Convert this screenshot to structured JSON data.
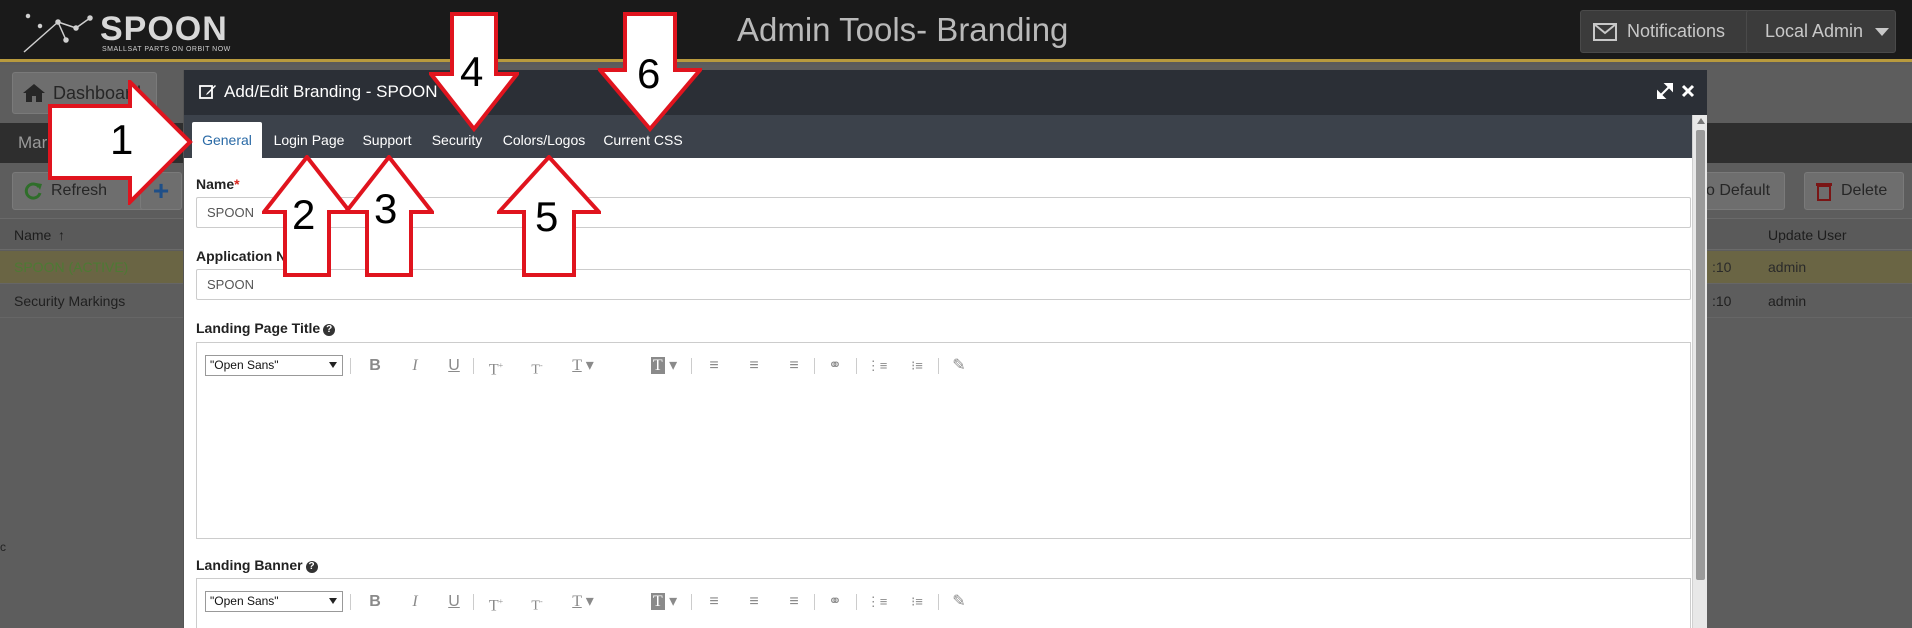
{
  "app": {
    "logo_text": "SPOON",
    "logo_tagline": "SMALLSAT PARTS ON ORBIT NOW",
    "title": "Admin Tools- Branding",
    "notifications_label": "Notifications",
    "user_label": "Local Admin"
  },
  "background": {
    "breadcrumb_label": "Dashboard",
    "strip_label": "Mar",
    "refresh_label": "Refresh",
    "add_label": "+",
    "default_label": "o Default",
    "delete_label": "Delete",
    "table": {
      "col_name": "Name",
      "col_update_user": "Update User",
      "rows": [
        {
          "name": "SPOON (ACTIVE)",
          "time": ":10",
          "user": "admin"
        },
        {
          "name": "Security Markings",
          "time": ":10",
          "user": "admin"
        }
      ]
    }
  },
  "modal": {
    "title": "Add/Edit Branding - SPOON",
    "tabs": [
      {
        "label": "General",
        "active": true
      },
      {
        "label": "Login Page",
        "active": false
      },
      {
        "label": "Support",
        "active": false
      },
      {
        "label": "Security",
        "active": false
      },
      {
        "label": "Colors/Logos",
        "active": false
      },
      {
        "label": "Current CSS",
        "active": false
      }
    ],
    "form": {
      "name_label": "Name",
      "name_required": "*",
      "name_value": "SPOON",
      "app_name_label": "Application N",
      "app_name_value": "SPOON",
      "landing_title_label": "Landing Page Title",
      "landing_banner_label": "Landing Banner",
      "font_value": "\"Open Sans\""
    }
  },
  "annotations": [
    "1",
    "2",
    "3",
    "4",
    "5",
    "6"
  ],
  "colors": {
    "topbar": "#1a1a1a",
    "accent_gold": "#b89a3e",
    "modal_header": "#2b2f36",
    "tabbar": "#3c424b",
    "active_tab_text": "#2a6aa6",
    "arrow_stroke": "#e0141e"
  }
}
